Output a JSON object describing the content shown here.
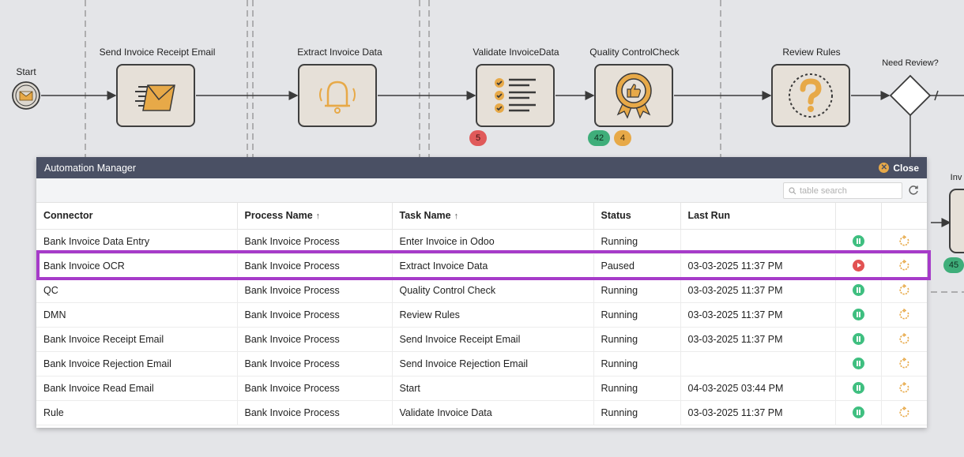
{
  "process": {
    "start_label": "Start",
    "tasks": [
      {
        "label": "Send Invoice Receipt Email",
        "icon": "envelope-icon"
      },
      {
        "label": "Extract Invoice Data",
        "icon": "bell-icon"
      },
      {
        "label": "Validate InvoiceData",
        "icon": "checklist-icon",
        "badges": [
          {
            "value": "5",
            "color": "red"
          }
        ]
      },
      {
        "label": "Quality ControlCheck",
        "icon": "thumbs-up-badge-icon",
        "badges": [
          {
            "value": "42",
            "color": "green"
          },
          {
            "value": "4",
            "color": "orange"
          }
        ]
      },
      {
        "label": "Review Rules",
        "icon": "question-icon"
      }
    ],
    "gateway_label": "Need Review?",
    "partial_label": "Inv",
    "partial_badge": "45"
  },
  "panel": {
    "title": "Automation Manager",
    "close_label": "Close",
    "search_placeholder": "table search",
    "columns": [
      "Connector",
      "Process Name",
      "Task Name",
      "Status",
      "Last Run"
    ],
    "rows": [
      {
        "connector": "Bank Invoice Data Entry",
        "process": "Bank Invoice Process",
        "task": "Enter Invoice in Odoo",
        "status": "Running",
        "last_run": "",
        "action": "pause"
      },
      {
        "connector": "Bank Invoice OCR",
        "process": "Bank Invoice Process",
        "task": "Extract Invoice Data",
        "status": "Paused",
        "last_run": "03-03-2025 11:37 PM",
        "action": "play"
      },
      {
        "connector": "QC",
        "process": "Bank Invoice Process",
        "task": "Quality Control Check",
        "status": "Running",
        "last_run": "03-03-2025 11:37 PM",
        "action": "pause"
      },
      {
        "connector": "DMN",
        "process": "Bank Invoice Process",
        "task": "Review Rules",
        "status": "Running",
        "last_run": "03-03-2025 11:37 PM",
        "action": "pause"
      },
      {
        "connector": "Bank Invoice Receipt Email",
        "process": "Bank Invoice Process",
        "task": "Send Invoice Receipt Email",
        "status": "Running",
        "last_run": "03-03-2025 11:37 PM",
        "action": "pause"
      },
      {
        "connector": "Bank Invoice Rejection Email",
        "process": "Bank Invoice Process",
        "task": "Send Invoice Rejection Email",
        "status": "Running",
        "last_run": "",
        "action": "pause"
      },
      {
        "connector": "Bank Invoice Read Email",
        "process": "Bank Invoice Process",
        "task": "Start",
        "status": "Running",
        "last_run": "04-03-2025 03:44 PM",
        "action": "pause"
      },
      {
        "connector": "Rule",
        "process": "Bank Invoice Process",
        "task": "Validate Invoice Data",
        "status": "Running",
        "last_run": "03-03-2025 11:37 PM",
        "action": "pause"
      }
    ]
  },
  "colors": {
    "header": "#4a5064",
    "accent": "#e7a948",
    "highlight": "#a63bc9",
    "running": "#3fbf80",
    "paused": "#e25252"
  }
}
